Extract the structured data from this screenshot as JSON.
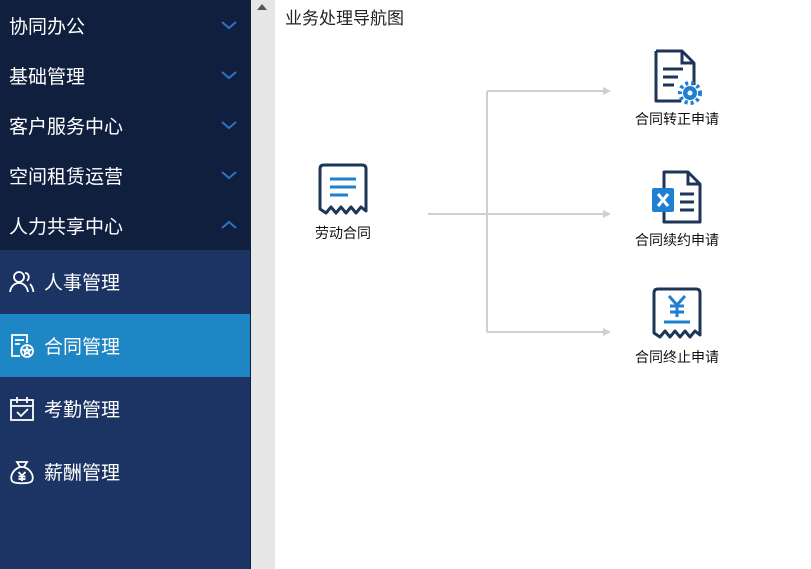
{
  "sidebar": {
    "groups": [
      {
        "label": "协同办公",
        "expanded": false
      },
      {
        "label": "基础管理",
        "expanded": false
      },
      {
        "label": "客户服务中心",
        "expanded": false
      },
      {
        "label": "空间租赁运营",
        "expanded": false
      },
      {
        "label": "人力共享中心",
        "expanded": true
      }
    ],
    "sub_items": [
      {
        "label": "人事管理",
        "icon": "people-icon",
        "active": false
      },
      {
        "label": "合同管理",
        "icon": "contract-icon",
        "active": true
      },
      {
        "label": "考勤管理",
        "icon": "calendar-check-icon",
        "active": false
      },
      {
        "label": "薪酬管理",
        "icon": "money-bag-icon",
        "active": false
      }
    ]
  },
  "main": {
    "title": "业务处理导航图",
    "source": {
      "label": "劳动合同",
      "icon": "receipt-icon"
    },
    "targets": [
      {
        "label": "合同转正申请",
        "icon": "document-gear-icon"
      },
      {
        "label": "合同续约申请",
        "icon": "excel-document-icon"
      },
      {
        "label": "合同终止申请",
        "icon": "yen-receipt-icon"
      }
    ]
  },
  "colors": {
    "sidebar_group_bg": "#0f1f3d",
    "sidebar_sub_bg": "#1c3463",
    "active_item_bg": "#1f86c6",
    "icon_dark": "#1d3557",
    "icon_accent": "#1f7fd0",
    "flow_line": "#cfcfcf"
  }
}
